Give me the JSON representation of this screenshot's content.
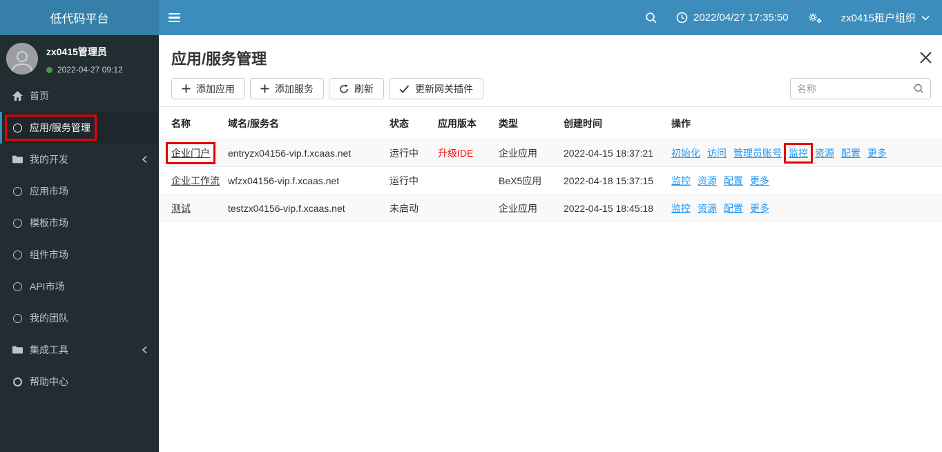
{
  "app": {
    "logo": "低代码平台"
  },
  "topbar": {
    "datetime": "2022/04/27 17:35:50",
    "org": "zx0415租户组织"
  },
  "sidebar": {
    "user": {
      "name": "zx0415管理员",
      "login_time": "2022-04-27 09:12"
    },
    "items": [
      {
        "label": "首页",
        "icon": "home"
      },
      {
        "label": "应用/服务管理",
        "icon": "circle",
        "active": true,
        "annotated": true
      },
      {
        "label": "我的开发",
        "icon": "folder",
        "chevron": true
      },
      {
        "label": "应用市场",
        "icon": "circle"
      },
      {
        "label": "模板市场",
        "icon": "circle"
      },
      {
        "label": "组件市场",
        "icon": "circle"
      },
      {
        "label": "API市场",
        "icon": "circle"
      },
      {
        "label": "我的团队",
        "icon": "circle"
      },
      {
        "label": "集成工具",
        "icon": "folder",
        "chevron": true
      },
      {
        "label": "帮助中心",
        "icon": "circle-bold"
      }
    ]
  },
  "main": {
    "title": "应用/服务管理",
    "toolbar": {
      "add_app": "添加应用",
      "add_service": "添加服务",
      "refresh": "刷新",
      "update_gateway": "更新网关插件"
    },
    "search_placeholder": "名称",
    "table": {
      "headers": [
        "名称",
        "域名/服务名",
        "状态",
        "应用版本",
        "类型",
        "创建时间",
        "操作"
      ],
      "rows": [
        {
          "name": "企业门户",
          "name_annotated": true,
          "domain": "entryzx04156-vip.f.xcaas.net",
          "status": "运行中",
          "version": "升级IDE",
          "type": "企业应用",
          "created": "2022-04-15 18:37:21",
          "actions": [
            "初始化",
            "访问",
            "管理员账号",
            "监控",
            "资源",
            "配置",
            "更多"
          ],
          "annotated_action": "监控"
        },
        {
          "name": "企业工作流",
          "domain": "wfzx04156-vip.f.xcaas.net",
          "status": "运行中",
          "version": "",
          "type": "BeX5应用",
          "created": "2022-04-18 15:37:15",
          "actions": [
            "监控",
            "资源",
            "配置",
            "更多"
          ]
        },
        {
          "name": "测试",
          "domain": "testzx04156-vip.f.xcaas.net",
          "status": "未启动",
          "version": "",
          "type": "企业应用",
          "created": "2022-04-15 18:45:18",
          "actions": [
            "监控",
            "资源",
            "配置",
            "更多"
          ]
        }
      ]
    }
  },
  "colors": {
    "navbar": "#3c8dbc",
    "logo_bar": "#367fa9",
    "sidebar": "#222d32",
    "sidebar_active_bg": "#1e282c",
    "action_link": "#2196f3",
    "version_alert": "#ff0000",
    "annotation_box": "#e60000",
    "online_dot": "#3f9b48"
  }
}
